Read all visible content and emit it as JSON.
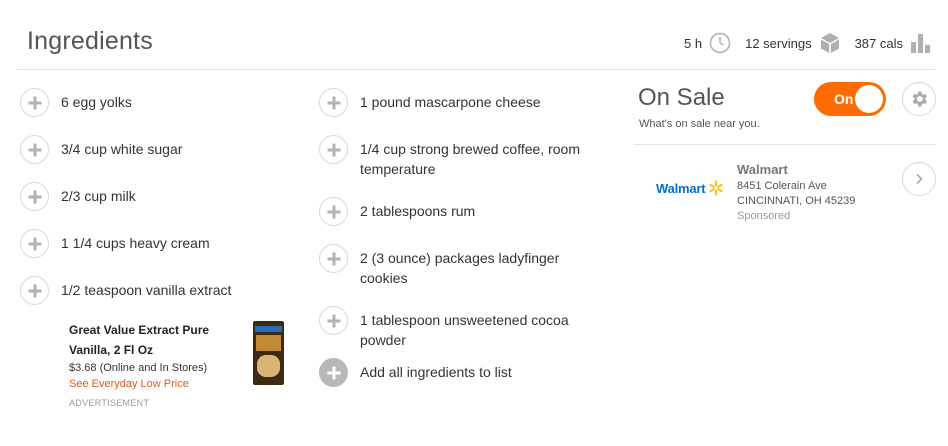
{
  "header": {
    "title": "Ingredients",
    "time": "5 h",
    "servings": "12 servings",
    "calories": "387 cals"
  },
  "ingredients_col1": [
    "6 egg yolks",
    "3/4 cup white sugar",
    "2/3 cup milk",
    "1 1/4 cups heavy cream",
    "1/2 teaspoon vanilla extract"
  ],
  "ingredients_col2": [
    "1 pound mascarpone cheese",
    "1/4 cup strong brewed coffee, room temperature",
    "2 tablespoons rum",
    "2 (3 ounce) packages ladyfinger cookies",
    "1 tablespoon unsweetened cocoa powder"
  ],
  "add_all_label": "Add all ingredients to list",
  "ad": {
    "product_name": "Great Value Extract Pure Vanilla, 2 Fl Oz",
    "price": "$3.68 (Online and In Stores)",
    "link": "See Everyday Low Price",
    "tag": "ADVERTISEMENT"
  },
  "on_sale": {
    "title": "On Sale",
    "subtitle": "What's on sale near you.",
    "toggle_label": "On",
    "toggle_on": true,
    "accent_color": "#ff6b00"
  },
  "store": {
    "logo_text": "Walmart",
    "name": "Walmart",
    "address_line1": "8451 Colerain Ave",
    "address_line2": "CINCINNATI, OH 45239",
    "sponsored": "Sponsored"
  }
}
